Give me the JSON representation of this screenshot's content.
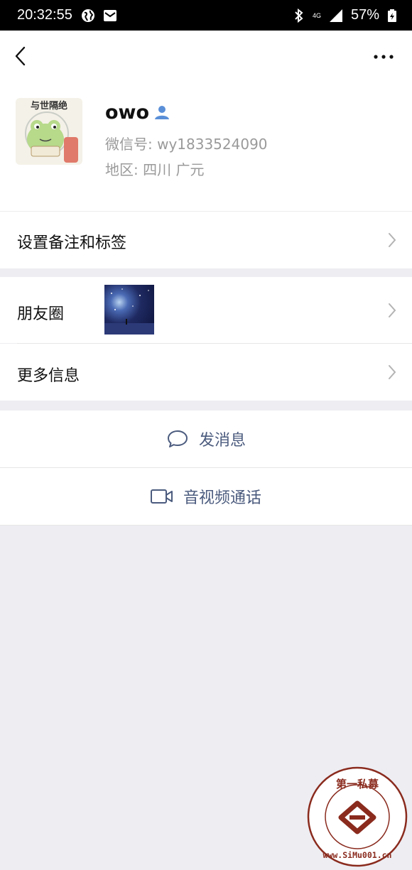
{
  "status_bar": {
    "time": "20:32:55",
    "network": "4G",
    "battery": "57%"
  },
  "profile": {
    "name": "owo",
    "avatar_text": "与世隔绝",
    "wechat_id": "微信号: wy1833524090",
    "region": "地区: 四川  广元"
  },
  "menu": {
    "set_remark": "设置备注和标签",
    "moments": "朋友圈",
    "more_info": "更多信息"
  },
  "actions": {
    "message": "发消息",
    "call": "音视频通话"
  },
  "watermark": {
    "brand": "第一私募",
    "url": "www.SiMu001.cn"
  }
}
